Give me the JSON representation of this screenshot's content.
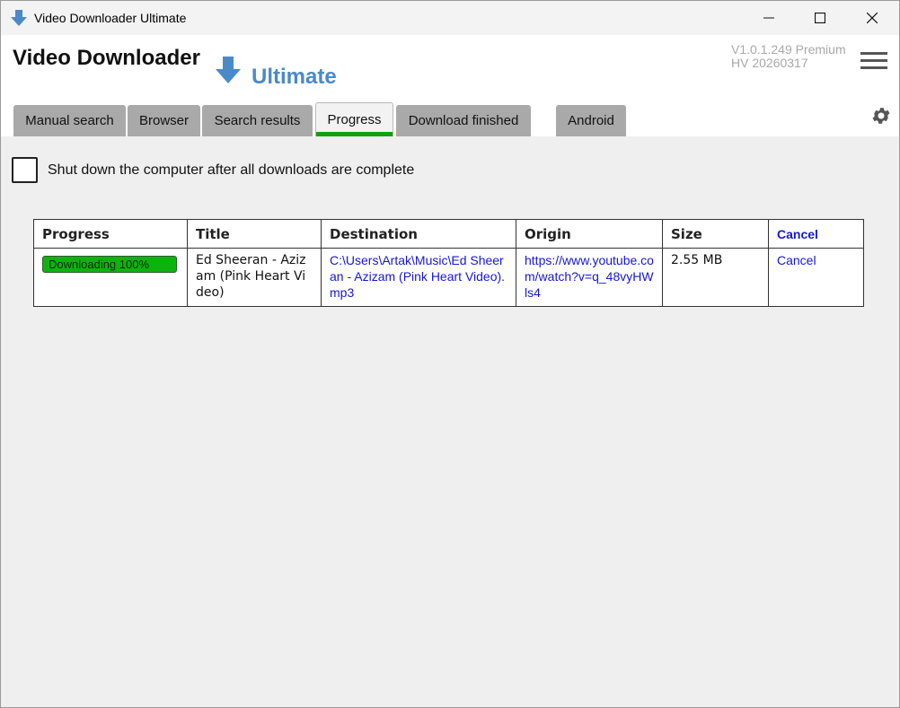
{
  "window": {
    "title": "Video Downloader Ultimate",
    "accent_color": "#4a8ac9",
    "progress_color": "#0db30d"
  },
  "header": {
    "app_title": "Video Downloader",
    "app_subtitle": "Ultimate",
    "version_line1": "V1.0.1.249 Premium",
    "version_line2": "HV 20260317"
  },
  "tabs": [
    {
      "label": "Manual search"
    },
    {
      "label": "Browser"
    },
    {
      "label": "Search results"
    },
    {
      "label": "Progress",
      "active": true
    },
    {
      "label": "Download finished"
    },
    {
      "label": "Android"
    }
  ],
  "options": {
    "shutdown_label": "Shut down the computer after all downloads are complete",
    "shutdown_checked": false
  },
  "table": {
    "headers": {
      "progress": "Progress",
      "title": "Title",
      "destination": "Destination",
      "origin": "Origin",
      "size": "Size",
      "cancel": "Cancel"
    },
    "rows": [
      {
        "progress_text": "Downloading 100%",
        "progress_percent": 100,
        "title": "Ed Sheeran - Azizam (Pink Heart Video)",
        "destination": "C:\\Users\\Artak\\Music\\Ed Sheeran - Azizam (Pink Heart Video).mp3",
        "origin": "https://www.youtube.com/watch?v=q_48vyHWls4",
        "size": "2.55 MB",
        "cancel": "Cancel"
      }
    ]
  },
  "icons": [
    "app-download-icon",
    "minimize-icon",
    "maximize-icon",
    "close-icon",
    "logo-arrow-icon",
    "hamburger-menu-icon",
    "gear-icon"
  ]
}
